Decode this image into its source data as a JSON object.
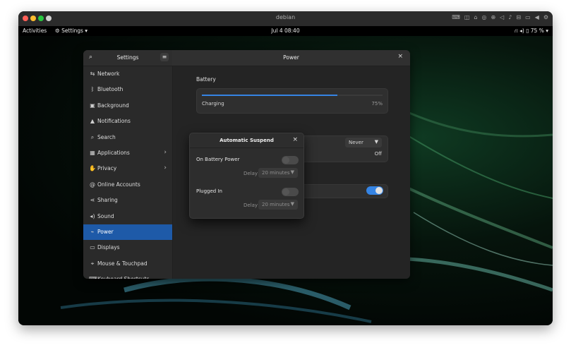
{
  "vm": {
    "title": "debian",
    "status_icons": [
      "keyboard-icon",
      "disk-icon",
      "usb-icon",
      "camera-icon",
      "network-icon",
      "speaker-icon",
      "mic-icon",
      "printer-icon",
      "display-icon",
      "back-icon",
      "settings-icon"
    ]
  },
  "topbar": {
    "activities": "Activities",
    "app_menu": "Settings",
    "clock": "Jul 4  08:40",
    "battery_pct": "75 %"
  },
  "settings": {
    "sidebar_title": "Settings",
    "panel_title": "Power",
    "items": [
      {
        "label": "Network",
        "icon": "network-icon",
        "arrow": false,
        "active": false
      },
      {
        "label": "Bluetooth",
        "icon": "bluetooth-icon",
        "arrow": false,
        "active": false
      },
      {
        "label": "Background",
        "icon": "background-icon",
        "arrow": false,
        "active": false
      },
      {
        "label": "Notifications",
        "icon": "bell-icon",
        "arrow": false,
        "active": false
      },
      {
        "label": "Search",
        "icon": "search-icon",
        "arrow": false,
        "active": false
      },
      {
        "label": "Applications",
        "icon": "apps-grid-icon",
        "arrow": true,
        "active": false
      },
      {
        "label": "Privacy",
        "icon": "hand-icon",
        "arrow": true,
        "active": false
      },
      {
        "label": "Online Accounts",
        "icon": "at-icon",
        "arrow": false,
        "active": false
      },
      {
        "label": "Sharing",
        "icon": "share-icon",
        "arrow": false,
        "active": false
      },
      {
        "label": "Sound",
        "icon": "speaker-icon",
        "arrow": false,
        "active": false
      },
      {
        "label": "Power",
        "icon": "power-icon",
        "arrow": false,
        "active": true
      },
      {
        "label": "Displays",
        "icon": "display-icon",
        "arrow": false,
        "active": false
      },
      {
        "label": "Mouse & Touchpad",
        "icon": "mouse-icon",
        "arrow": false,
        "active": false
      },
      {
        "label": "Keyboard Shortcuts",
        "icon": "keyboard-icon",
        "arrow": false,
        "active": false
      }
    ],
    "battery": {
      "section_title": "Battery",
      "status": "Charging",
      "percent_label": "75%",
      "level": 0.75
    },
    "background_rows": {
      "dropdown_value": "Never",
      "value_label": "Off"
    }
  },
  "dialog": {
    "title": "Automatic Suspend",
    "battery_label": "On Battery Power",
    "battery_delay_label": "Delay",
    "battery_delay_value": "20 minutes",
    "plugged_label": "Plugged In",
    "plugged_delay_label": "Delay",
    "plugged_delay_value": "20 minutes"
  },
  "colors": {
    "accent": "#1e5aa8",
    "bar": "#3584e4"
  }
}
